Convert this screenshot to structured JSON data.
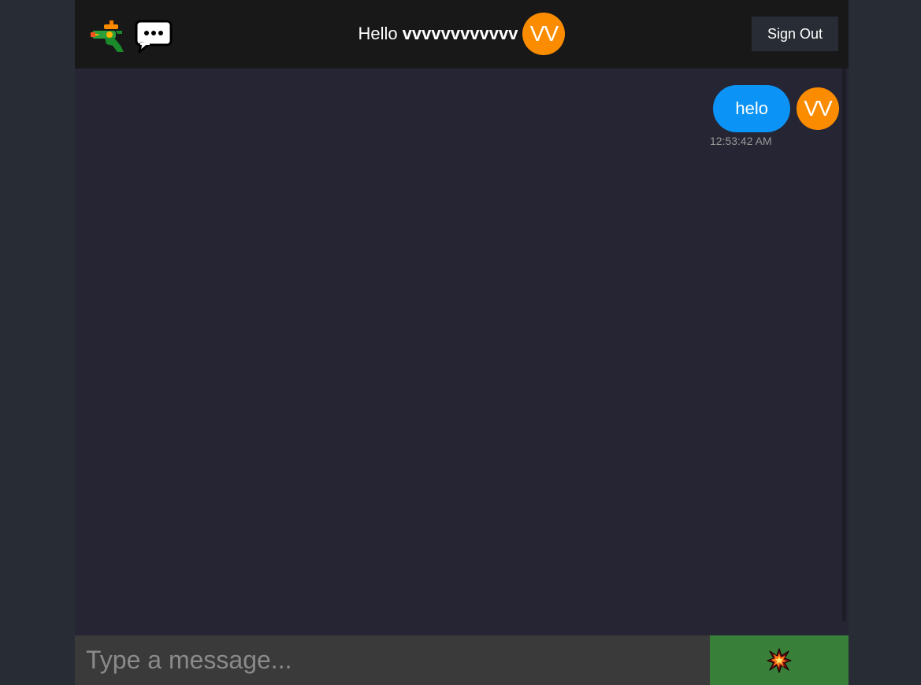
{
  "header": {
    "logo_icons": [
      "water-pistol-icon",
      "speech-bubble-icon"
    ],
    "greeting_prefix": "Hello",
    "username": "vvvvvvvvvvvv",
    "avatar_initials": "VV",
    "signout_label": "Sign Out"
  },
  "messages": [
    {
      "text": "helo",
      "avatar_initials": "VV",
      "time": "12:53:42 AM",
      "sent_by_me": true
    }
  ],
  "composer": {
    "placeholder": "Type a message...",
    "value": "",
    "send_icon": "collision-icon"
  },
  "colors": {
    "avatar": "#fb8c00",
    "sent_bubble": "#0b93f6",
    "send_button": "#38803a",
    "header": "#181818",
    "chat_background": "#262533"
  }
}
